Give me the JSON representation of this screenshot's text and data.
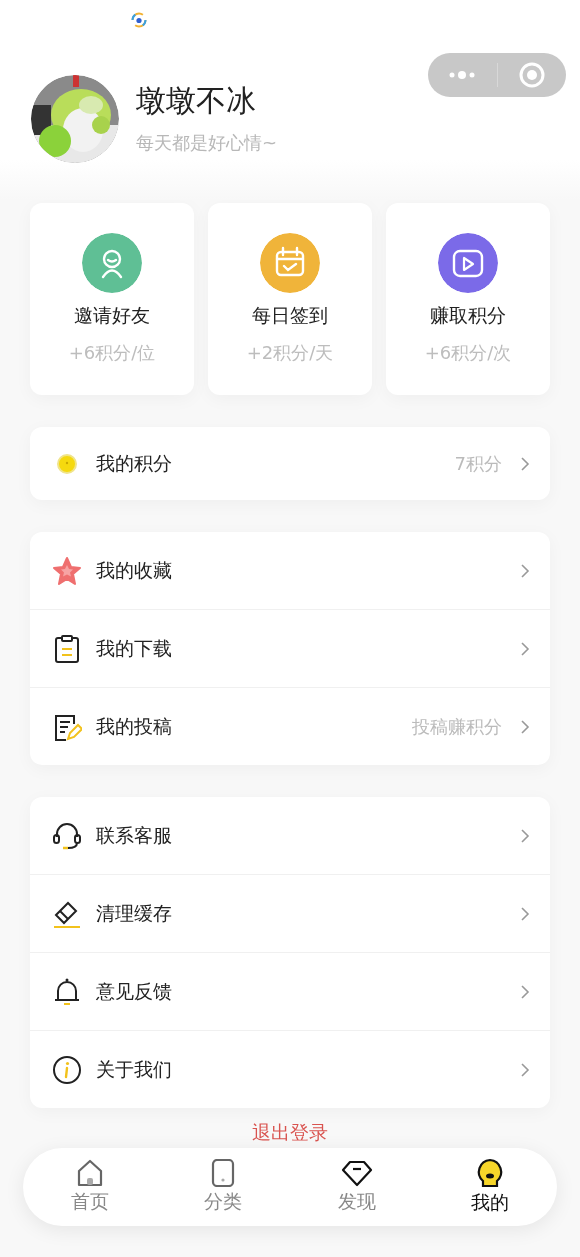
{
  "profile": {
    "name": "墩墩不冰",
    "motto": "每天都是好心情~"
  },
  "cards": [
    {
      "title": "邀请好友",
      "reward": "+6积分/位",
      "color": "#5fbf95"
    },
    {
      "title": "每日签到",
      "reward": "+2积分/天",
      "color": "#f0b43a"
    },
    {
      "title": "赚取积分",
      "reward": "+6积分/次",
      "color": "#7b6ae8"
    }
  ],
  "points": {
    "label": "我的积分",
    "value": "7积分"
  },
  "menu_groups": [
    [
      {
        "label": "我的收藏"
      },
      {
        "label": "我的下载"
      },
      {
        "label": "我的投稿",
        "note": "投稿赚积分"
      }
    ],
    [
      {
        "label": "联系客服"
      },
      {
        "label": "清理缓存"
      },
      {
        "label": "意见反馈"
      },
      {
        "label": "关于我们"
      }
    ]
  ],
  "logout": "退出登录",
  "tabs": [
    {
      "label": "首页",
      "selected": false
    },
    {
      "label": "分类",
      "selected": false
    },
    {
      "label": "发现",
      "selected": false
    },
    {
      "label": "我的",
      "selected": true
    }
  ]
}
